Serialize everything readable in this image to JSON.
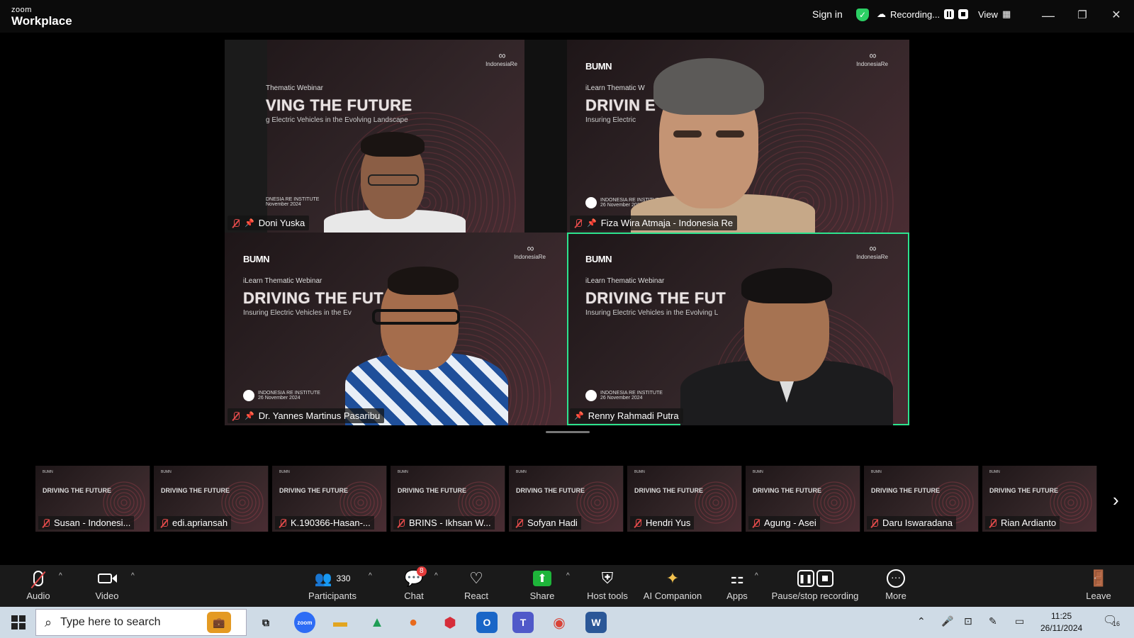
{
  "titlebar": {
    "logo_small": "zoom",
    "logo_big": "Workplace",
    "sign_in": "Sign in",
    "recording": "Recording...",
    "view": "View",
    "minimize": "—",
    "restore": "❐",
    "close": "✕"
  },
  "tiles": [
    {
      "name": "Doni Yuska",
      "headline": "VING THE FUTURE",
      "sub": "Thematic Webinar",
      "tagline": "g Electric Vehicles in the Evolving Landscape",
      "brand": "",
      "inst": "DNESIA RE INSTITUTE",
      "date": "November 2024"
    },
    {
      "name": "Fiza Wira Atmaja - Indonesia Re",
      "headline": "DRIVIN            E",
      "sub": "iLearn Thematic W",
      "tagline": "Insuring Electric",
      "brand": "BUMN",
      "inst": "INDONESIA RE INSTITUTE",
      "date": "26 November 2024"
    },
    {
      "name": "Dr. Yannes Martinus Pasaribu",
      "headline": "DRIVING THE FUT",
      "sub": "iLearn Thematic Webinar",
      "tagline": "Insuring Electric Vehicles in the Ev",
      "brand": "BUMN",
      "inst": "INDONESIA RE INSTITUTE",
      "date": "26 November 2024"
    },
    {
      "name": "Renny Rahmadi Putra",
      "headline": "DRIVING THE FUT",
      "sub": "iLearn Thematic Webinar",
      "tagline": "Insuring Electric Vehicles in the Evolving L",
      "brand": "BUMN",
      "inst": "INDONESIA RE INSTITUTE",
      "date": "26 November 2024"
    }
  ],
  "brand_right": "IndonesiaRe",
  "thumb_headline": "DRIVING THE FUTURE",
  "thumb_sub": "BUMN",
  "thumbs": [
    "Susan - Indonesi...",
    "edi.apriansah",
    "K.190366-Hasan-...",
    "BRINS - Ikhsan W...",
    "Sofyan Hadi",
    "Hendri Yus",
    "Agung - Asei",
    "Daru Iswaradana",
    "Rian Ardianto"
  ],
  "toolbar": {
    "audio": "Audio",
    "video": "Video",
    "participants": "Participants",
    "participants_count": "330",
    "chat": "Chat",
    "chat_badge": "8",
    "react": "React",
    "share": "Share",
    "host_tools": "Host tools",
    "ai_companion": "AI Companion",
    "apps": "Apps",
    "pause_stop": "Pause/stop recording",
    "more": "More",
    "leave": "Leave"
  },
  "taskbar": {
    "search_placeholder": "Type here to search",
    "time": "11:25",
    "date": "26/11/2024",
    "notifications": "16"
  },
  "colors": {
    "active_border": "#2de38e",
    "mic_off": "#e04a4a",
    "share": "#1eb53a",
    "badge": "#e53b3b"
  }
}
